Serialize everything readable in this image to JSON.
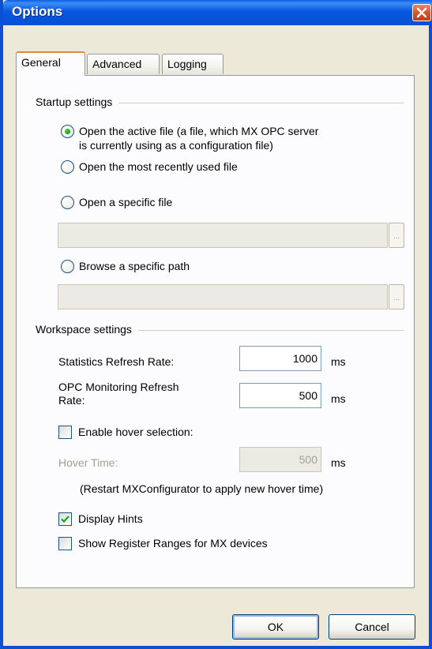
{
  "window": {
    "title": "Options"
  },
  "tabs": [
    {
      "label": "General",
      "active": true
    },
    {
      "label": "Advanced",
      "active": false
    },
    {
      "label": "Logging",
      "active": false
    }
  ],
  "startup": {
    "group_label": "Startup settings",
    "options": [
      {
        "label_line1": "Open the active file (a file, which MX OPC server",
        "label_line2": "is currently using as a configuration file)",
        "checked": true
      },
      {
        "label": "Open the most recently used file",
        "checked": false
      },
      {
        "label": "Open a specific file",
        "checked": false
      },
      {
        "label": "Browse a specific path",
        "checked": false
      }
    ],
    "file_input_value": "",
    "path_input_value": "",
    "browse_label": "..."
  },
  "workspace": {
    "group_label": "Workspace settings",
    "stats_refresh_label": "Statistics Refresh Rate:",
    "stats_refresh_value": "1000",
    "stats_unit": "ms",
    "opc_refresh_label_line1": "OPC Monitoring Refresh",
    "opc_refresh_label_line2": "Rate:",
    "opc_refresh_value": "500",
    "opc_unit": "ms",
    "hover_selection_label": "Enable hover selection:",
    "hover_selection_checked": false,
    "hover_time_label": "Hover Time:",
    "hover_time_value": "500",
    "hover_unit": "ms",
    "hover_note": "(Restart MXConfigurator to apply new hover time)",
    "display_hints_label": "Display Hints",
    "display_hints_checked": true,
    "register_ranges_label": "Show Register Ranges for MX devices",
    "register_ranges_checked": false
  },
  "buttons": {
    "ok": "OK",
    "cancel": "Cancel"
  },
  "colors": {
    "titlebar": "#0a5fe4",
    "dialog_bg": "#ece9d8",
    "panel_bg": "#fcfcfe",
    "radio_dot": "#21a121",
    "tab_highlight": "#e68b2c"
  }
}
